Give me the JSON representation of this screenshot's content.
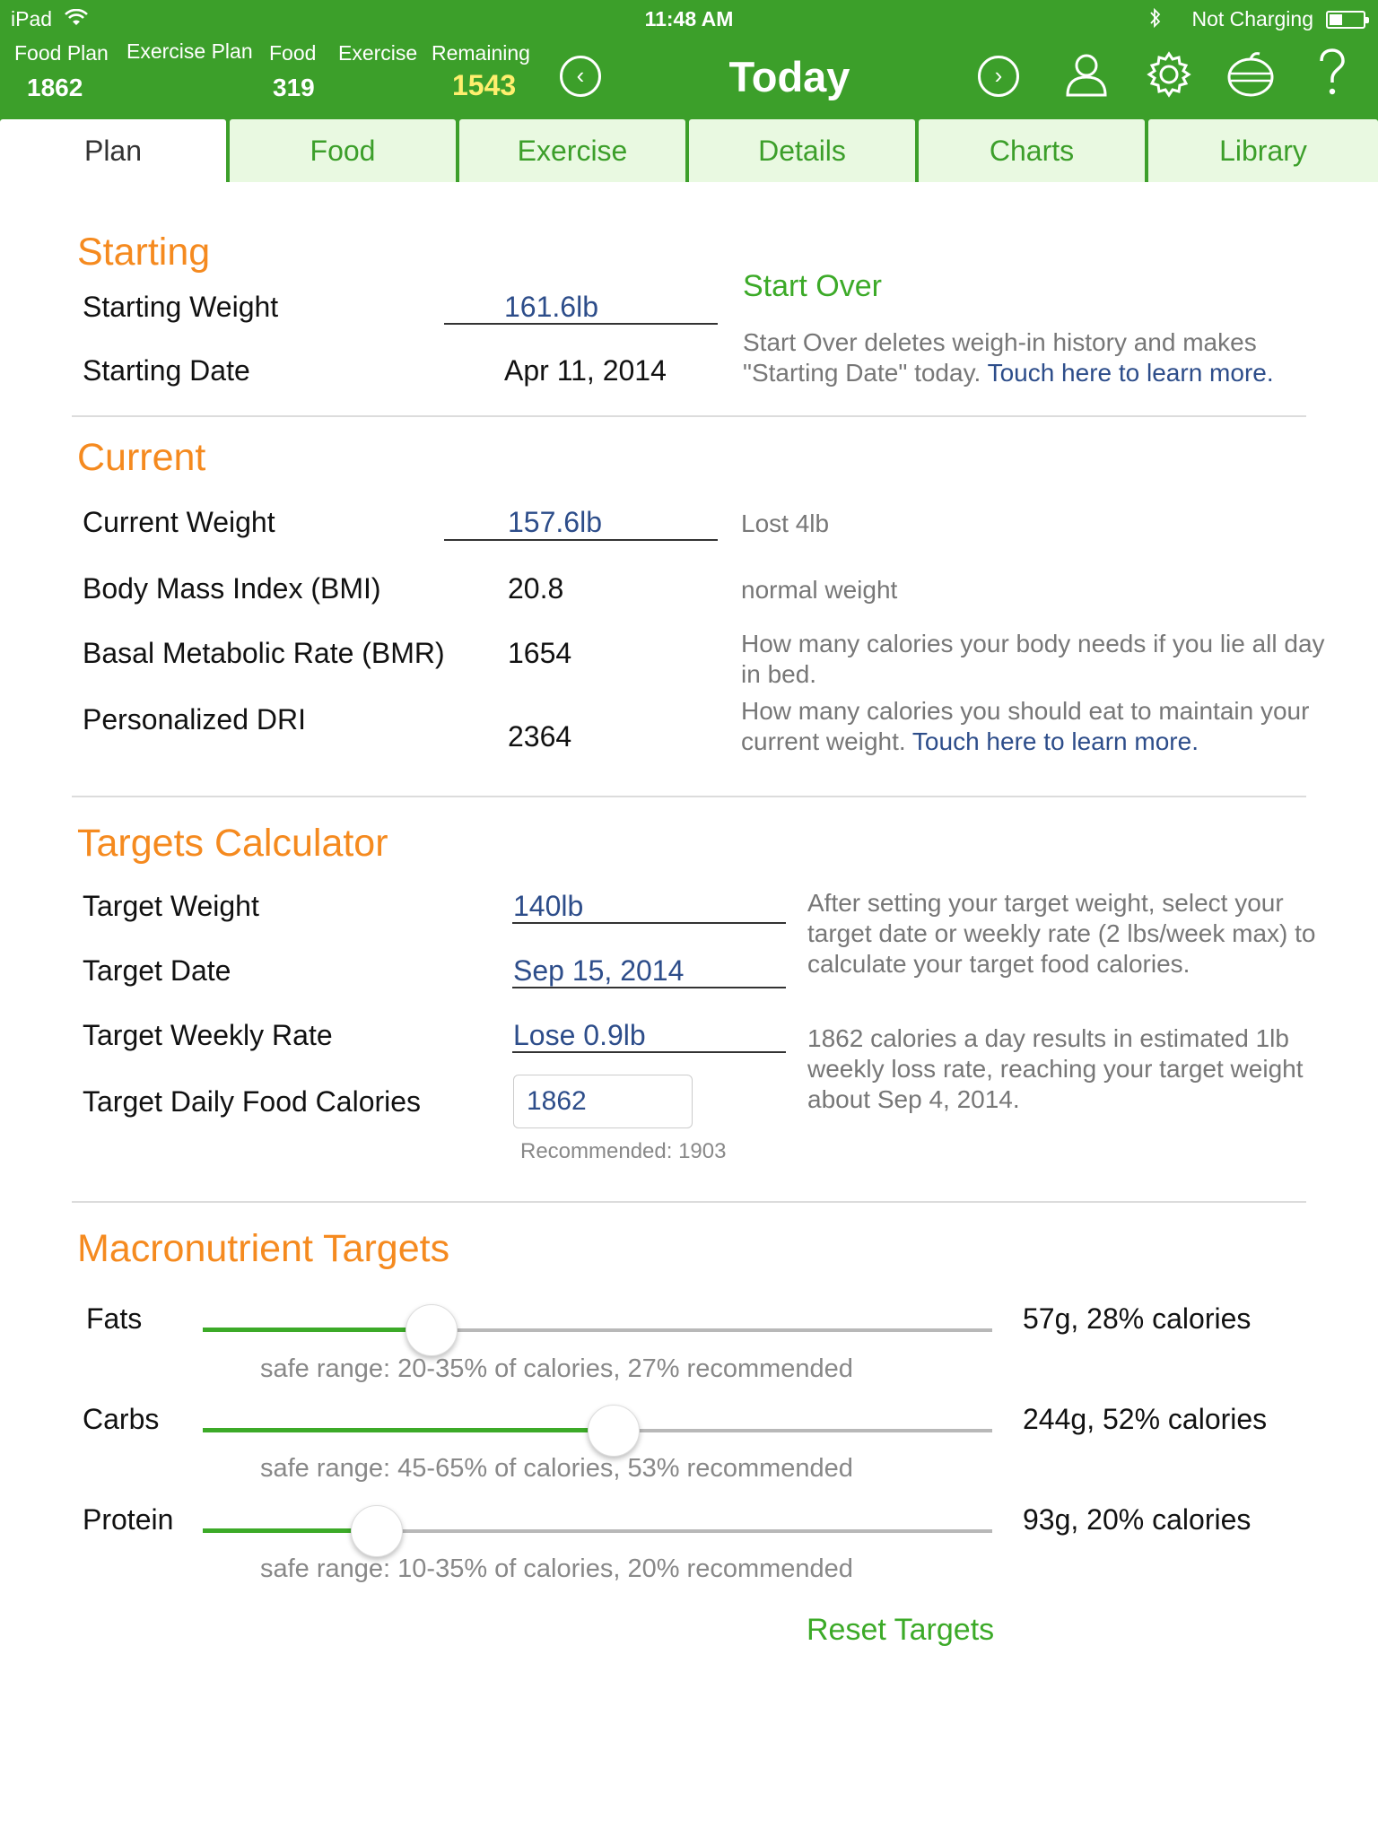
{
  "status_bar": {
    "device": "iPad",
    "time": "11:48 AM",
    "charging": "Not Charging"
  },
  "header": {
    "stats": [
      {
        "label": "Food Plan",
        "value": "1862"
      },
      {
        "label": "Exercise Plan",
        "value": ""
      },
      {
        "label": "Food",
        "value": "319"
      },
      {
        "label": "Exercise",
        "value": ""
      },
      {
        "label": "Remaining",
        "value": "1543"
      }
    ],
    "title": "Today",
    "icons": [
      "chevron-left-icon",
      "chevron-right-icon",
      "user-icon",
      "gear-icon",
      "apple-icon",
      "help-icon"
    ]
  },
  "tabs": [
    {
      "label": "Plan",
      "active": true
    },
    {
      "label": "Food"
    },
    {
      "label": "Exercise"
    },
    {
      "label": "Details"
    },
    {
      "label": "Charts"
    },
    {
      "label": "Library"
    }
  ],
  "starting": {
    "title": "Starting",
    "weight_label": "Starting Weight",
    "weight_value": "161.6lb",
    "date_label": "Starting Date",
    "date_value": "Apr 11, 2014",
    "start_over": "Start Over",
    "note": "Start Over deletes weigh-in history and makes \"Starting Date\" today.",
    "learn_more": "Touch here to learn more."
  },
  "current": {
    "title": "Current",
    "weight_label": "Current Weight",
    "weight_value": "157.6lb",
    "weight_note": "Lost 4lb",
    "bmi_label": "Body Mass Index (BMI)",
    "bmi_value": "20.8",
    "bmi_note": "normal weight",
    "bmr_label": "Basal Metabolic Rate (BMR)",
    "bmr_value": "1654",
    "bmr_note": "How many calories your body needs if you lie all day in bed.",
    "dri_label": "Personalized DRI",
    "dri_value": "2364",
    "dri_note": "How many calories you should eat to maintain your current weight.",
    "learn_more": "Touch here to learn more."
  },
  "targets": {
    "title": "Targets Calculator",
    "weight_label": "Target Weight",
    "weight_value": "140lb",
    "date_label": "Target Date",
    "date_value": "Sep 15, 2014",
    "rate_label": "Target Weekly Rate",
    "rate_value": "Lose 0.9lb",
    "calories_label": "Target Daily Food Calories",
    "calories_value": "1862",
    "recommended": "Recommended: 1903",
    "note1": "After setting your target weight, select your target date or weekly rate (2 lbs/week max) to calculate your target food calories.",
    "note2": "1862 calories a day results in estimated 1lb weekly loss rate, reaching your target weight about Sep 4, 2014."
  },
  "macros": {
    "title": "Macronutrient Targets",
    "items": [
      {
        "label": "Fats",
        "value": "57g, 28% calories",
        "safe": "safe range: 20-35% of calories, 27% recommended",
        "level": 0.29
      },
      {
        "label": "Carbs",
        "value": "244g, 52% calories",
        "safe": "safe range: 45-65% of calories, 53% recommended",
        "level": 0.52
      },
      {
        "label": "Protein",
        "value": "93g, 20% calories",
        "safe": "safe range: 10-35% of calories, 20% recommended",
        "level": 0.22
      }
    ],
    "reset": "Reset Targets"
  },
  "colors": {
    "brand_green": "#3c9f2a",
    "accent_orange": "#f58a1f",
    "link_blue": "#2d4d8a",
    "remaining_yellow": "#ffef6e"
  }
}
